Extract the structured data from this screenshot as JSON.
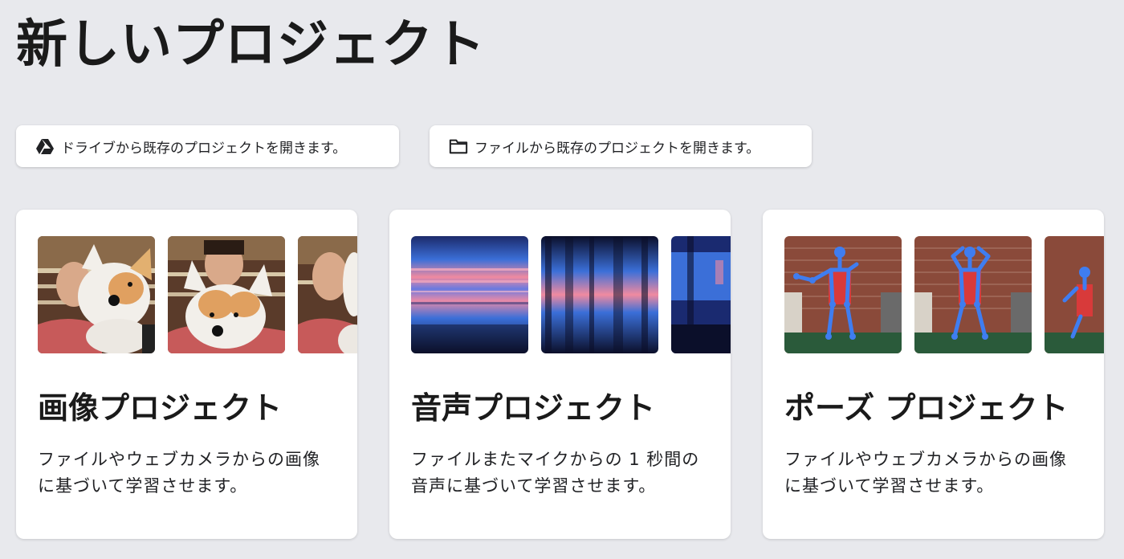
{
  "page": {
    "title": "新しいプロジェクト"
  },
  "open_buttons": {
    "drive": {
      "label": "ドライブから既存のプロジェクトを開きます。",
      "icon": "google-drive-icon"
    },
    "file": {
      "label": "ファイルから既存のプロジェクトを開きます。",
      "icon": "folder-icon"
    }
  },
  "cards": {
    "image": {
      "title": "画像プロジェクト",
      "description": "ファイルやウェブカメラからの画像に基づいて学習させます。"
    },
    "audio": {
      "title": "音声プロジェクト",
      "description": "ファイルまたマイクからの 1 秒間の音声に基づいて学習させます。"
    },
    "pose": {
      "title": "ポーズ プロジェクト",
      "description": "ファイルやウェブカメラからの画像に基づいて学習させます。"
    }
  },
  "colors": {
    "background": "#e8e9ed",
    "card": "#ffffff",
    "spectrogram_low": "#0b0f2a",
    "spectrogram_mid": "#3b6fd8",
    "spectrogram_high": "#f08aa0",
    "pose_skeleton": "#3f7df0"
  }
}
